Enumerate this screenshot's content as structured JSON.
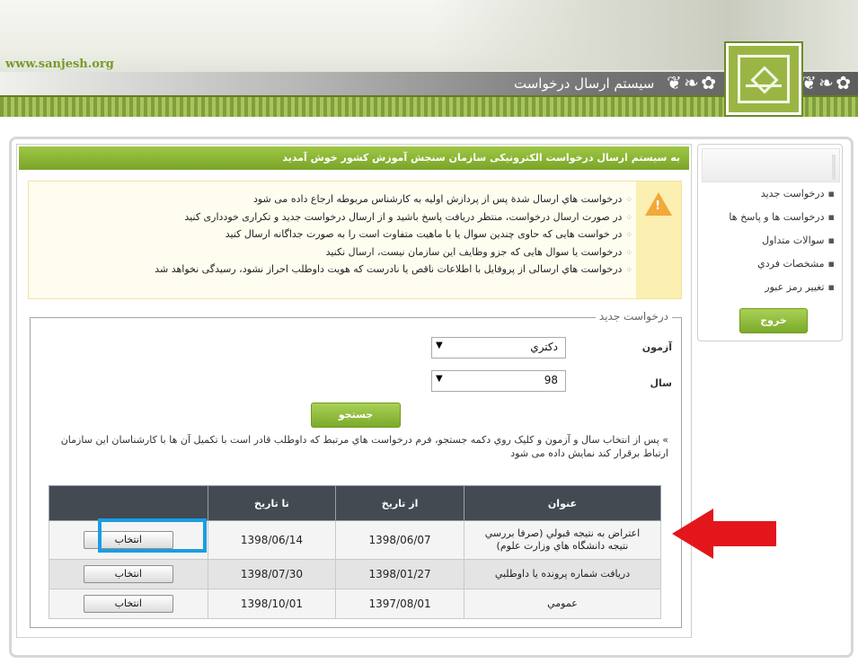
{
  "header": {
    "site_url": "www.sanjesh.org",
    "title": "سیستم ارسال درخواست",
    "ornament": "❦ ❧ ✿"
  },
  "sidebar": {
    "items": [
      {
        "label": "درخواست جديد"
      },
      {
        "label": "درخواست ها و پاسخ ها"
      },
      {
        "label": "سوالات متداول"
      },
      {
        "label": "مشخصات فردي"
      },
      {
        "label": "تغيير رمز عبور"
      }
    ],
    "logout_label": "خروج"
  },
  "main": {
    "welcome": "به سیستم ارسال درخواست الکترونیکی سازمان سنجش آموزش کشور خوش آمدید",
    "notices": [
      "درخواست هاي ارسال شدة پس از پردازش اولیه به کارشناس مربوطه ارجاع داده می شود",
      "در صورت ارسال درخواست، منتظر دریافت پاسخ باشید و از ارسال درخواست جدید و تکراری خودداری کنید",
      "در خواست هایی که حاوی چندین سوال یا با ماهیت متفاوت است را به صورت جداگانه ارسال کنید",
      "درخواست یا سوال هایی که جزو وظایف این سازمان نیست، ارسال نکنید",
      "درخواست هاي ارسالی از پروفایل با اطلاعات ناقص یا نادرست که هویت داوطلب احراز نشود، رسیدگی نخواهد شد"
    ],
    "form": {
      "legend": "درخواست جدید",
      "exam_label": "آزمون",
      "exam_value": "دكتري",
      "year_label": "سال",
      "year_value": "98",
      "search_label": "جستجو",
      "hint": "» پس از انتخاب سال و آزمون و کلیک روي دکمه جستجو، فرم درخواست هاي مرتبط که داوطلب قادر است با تکمیل آن ها با کارشناسان این سازمان ارتباط برقرار کند نمایش داده می شود"
    },
    "table": {
      "headers": [
        "عنوان",
        "از تاريخ",
        "تا تاريخ",
        ""
      ],
      "rows": [
        {
          "title_line1": "اعتراض به نتيجه قبولي (صرفا بررسي",
          "title_line2": "نتيجه دانشگاه هاي وزارت علوم)",
          "from": "1398/06/07",
          "to": "1398/06/14",
          "action": "انتخاب"
        },
        {
          "title_line1": "دريافت شماره پرونده يا داوطلبي",
          "title_line2": "",
          "from": "1398/01/27",
          "to": "1398/07/30",
          "action": "انتخاب"
        },
        {
          "title_line1": "عمومي",
          "title_line2": "",
          "from": "1397/08/01",
          "to": "1398/10/01",
          "action": "انتخاب"
        }
      ]
    }
  },
  "colors": {
    "accent_green": "#8bb835",
    "table_header": "#434a52",
    "highlight_blue": "#1b9de2",
    "arrow_red": "#e3161c",
    "warning": "#f1a93a"
  },
  "icons": {
    "warning": "warning-icon",
    "arrow": "red-arrow-annotation",
    "logo": "sanjesh-logo"
  }
}
